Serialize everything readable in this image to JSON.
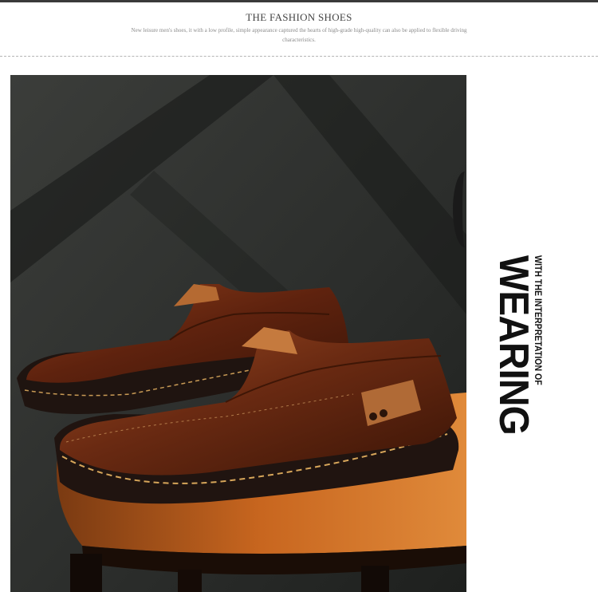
{
  "header": {
    "title": "THE FASHION SHOES",
    "subtitle": "New leisure men's shoes, it with a low profile, simple appearance captured the hearts of high-grade high-quality can also be applied to flexible driving characteristics."
  },
  "photo": {
    "alt": "brown leather slip-on loafers on a wooden stool"
  },
  "side_text": {
    "big": "WEARING",
    "small": "WITH THE INTERPRETATION OF"
  },
  "colors": {
    "leather": "#6a2a12",
    "stool_wood": "#c2651f",
    "background": "#2a2c2a"
  }
}
